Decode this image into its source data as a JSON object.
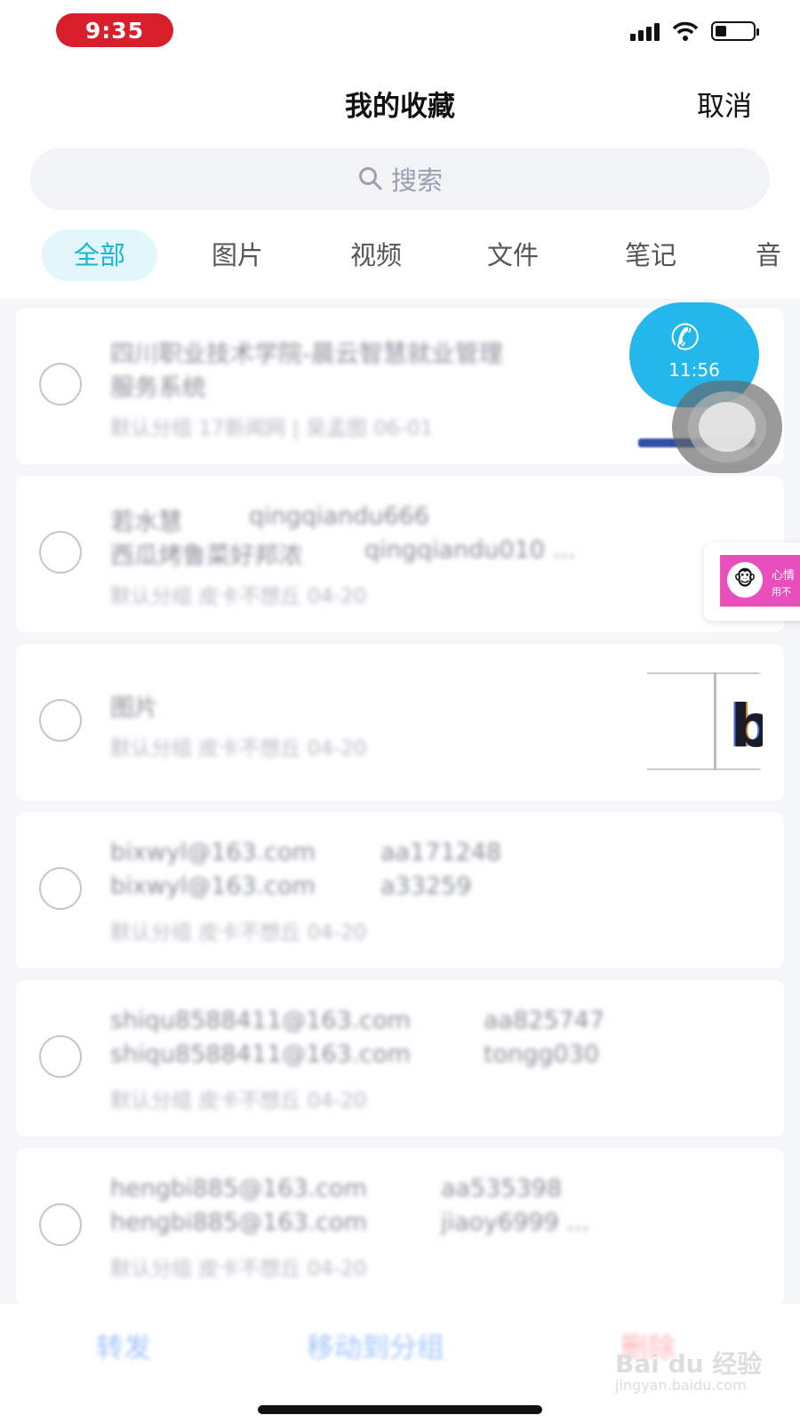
{
  "status": {
    "time": "9:35"
  },
  "nav": {
    "title": "我的收藏",
    "cancel": "取消"
  },
  "search": {
    "icon": "search-icon",
    "placeholder": "搜索"
  },
  "tabs": [
    {
      "label": "全部",
      "active": true
    },
    {
      "label": "图片"
    },
    {
      "label": "视频"
    },
    {
      "label": "文件"
    },
    {
      "label": "笔记"
    },
    {
      "label": "音"
    }
  ],
  "items": [
    {
      "l1": "四川职业技术学院-晨云智慧就业管理",
      "l2": "服务系统",
      "meta": "默认分组 17新闻网 | 吴孟图 06-01"
    },
    {
      "l1a": "若水慧",
      "l1b": "qingqiandu666",
      "l2a": "西瓜烤鲁菜好邦浓",
      "l2b": "qingqiandu010 ...",
      "meta": "默认分组 皮卡不想丘 04-20"
    },
    {
      "l1": "图片",
      "meta": "默认分组 皮卡不想丘 04-20",
      "thumb_letter": "b"
    },
    {
      "l1a": "bixwyl@163.com",
      "l1b": "aa171248",
      "l2a": "bixwyl@163.com",
      "l2b": "a33259",
      "meta": "默认分组 皮卡不想丘 04-20"
    },
    {
      "l1a": "shiqu8588411@163.com",
      "l1b": "aa825747",
      "l2a": "shiqu8588411@163.com",
      "l2b": "tongg030",
      "meta": "默认分组 皮卡不想丘 04-20"
    },
    {
      "l1a": "hengbi885@163.com",
      "l1b": "aa535398",
      "l2a": "hengbi885@163.com",
      "l2b": "jiaoy6999 ...",
      "meta": "默认分组 皮卡不想丘 04-20"
    }
  ],
  "call": {
    "icon": "phone-icon",
    "time": "11:56"
  },
  "toast": {
    "text1": "心情",
    "text2": "用不"
  },
  "bottom": {
    "forward": "转发",
    "move": "移动到分组",
    "delete": "删除",
    "forward_color": "#1e6fff",
    "delete_color": "#ff4d4f"
  },
  "watermark": {
    "brand": "Bai du 经验",
    "url": "jingyan.baidu.com"
  }
}
